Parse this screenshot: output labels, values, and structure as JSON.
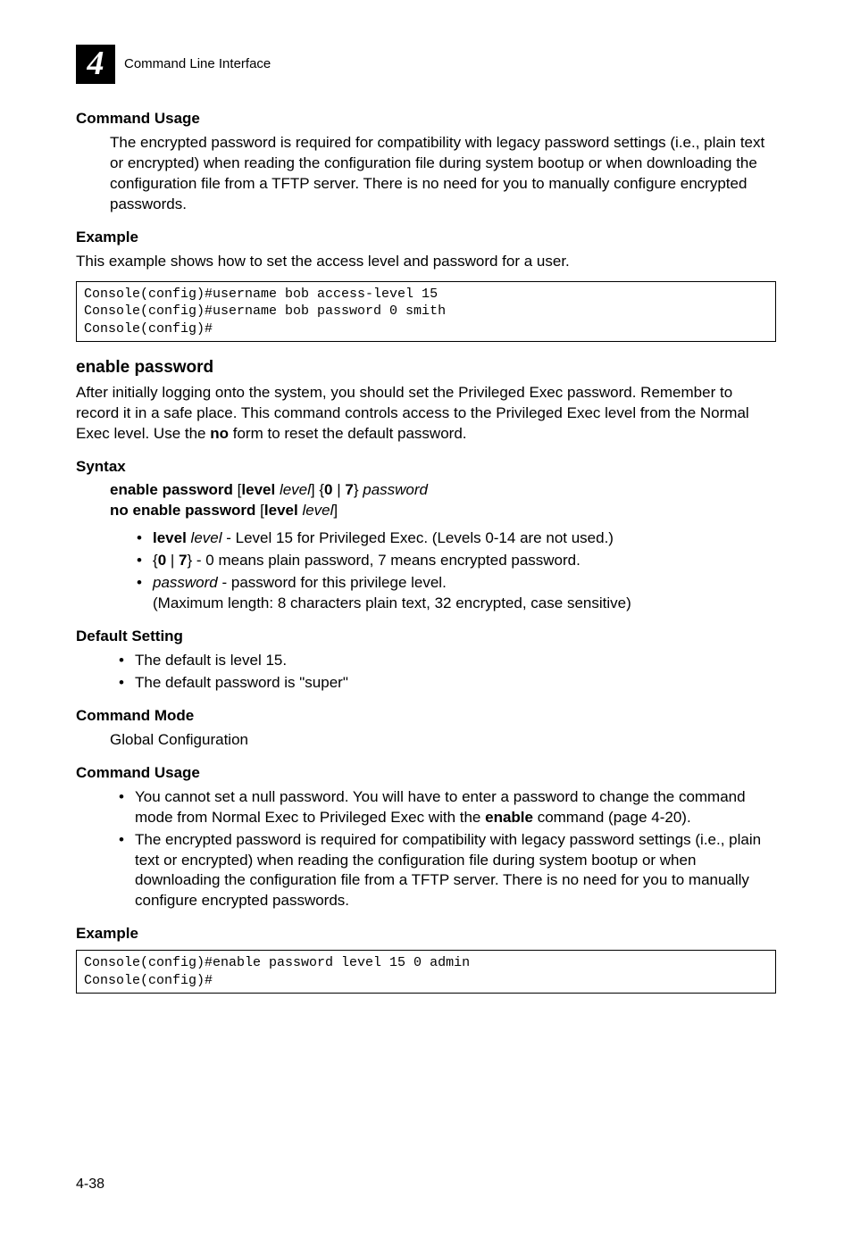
{
  "header": {
    "chapter_num": "4",
    "section": "Command Line Interface"
  },
  "cu1": {
    "title": "Command Usage",
    "para": "The encrypted password is required for compatibility with legacy password settings (i.e., plain text or encrypted) when reading the configuration file during system bootup or when downloading the configuration file from a TFTP server. There is no need for you to manually configure encrypted passwords."
  },
  "ex1": {
    "title": "Example",
    "intro": "This example shows how to set the access level and password for a user.",
    "code": "Console(config)#username bob access-level 15\nConsole(config)#username bob password 0 smith\nConsole(config)#"
  },
  "ep": {
    "title": "enable password",
    "para": "After initially logging onto the system, you should set the Privileged Exec password. Remember to record it in a safe place. This command controls access to the Privileged Exec level from the Normal Exec level. Use the ",
    "no": "no",
    "para2": " form to reset the default password."
  },
  "syntax": {
    "title": "Syntax",
    "l1_enable": "enable password",
    "l1_open": " [",
    "l1_level": "level",
    "l1_sp": " ",
    "l1_ilevel": "level",
    "l1_close_brace": "] {",
    "l1_0": "0",
    "l1_pipe": " | ",
    "l1_7": "7",
    "l1_closecurly": "} ",
    "l1_password": "password",
    "l2_no": "no enable password",
    "l2_open": " [",
    "l2_level": "level",
    "l2_sp": " ",
    "l2_ilevel": "level",
    "l2_close": "]",
    "b1_pre": "level",
    "b1_sp": " ",
    "b1_i": "level",
    "b1_txt": " - Level 15 for Privileged Exec. (Levels 0-14 are not used.)",
    "b2_open": "{",
    "b2_0": "0",
    "b2_pipe": " | ",
    "b2_7": "7",
    "b2_close": "}",
    "b2_txt": " - 0 means plain password, 7 means encrypted password.",
    "b3_i": "password",
    "b3_txt": " - password for this privilege level.",
    "b3_sub": "(Maximum length: 8 characters plain text, 32 encrypted, case sensitive)"
  },
  "ds": {
    "title": "Default Setting",
    "b1": "The default is level 15.",
    "b2": "The default password is \"super\""
  },
  "cm": {
    "title": "Command Mode",
    "text": "Global Configuration"
  },
  "cu2": {
    "title": "Command Usage",
    "b1a": "You cannot set a null password. You will have to enter a password to change the command mode from Normal Exec to Privileged Exec with the ",
    "b1b": "enable",
    "b1c": " command (page 4-20).",
    "b2": "The encrypted password is required for compatibility with legacy password settings (i.e., plain text or encrypted) when reading the configuration file during system bootup or when downloading the configuration file from a TFTP server. There is no need for you to manually configure encrypted passwords."
  },
  "ex2": {
    "title": "Example",
    "code": "Console(config)#enable password level 15 0 admin\nConsole(config)#"
  },
  "page_num": "4-38"
}
